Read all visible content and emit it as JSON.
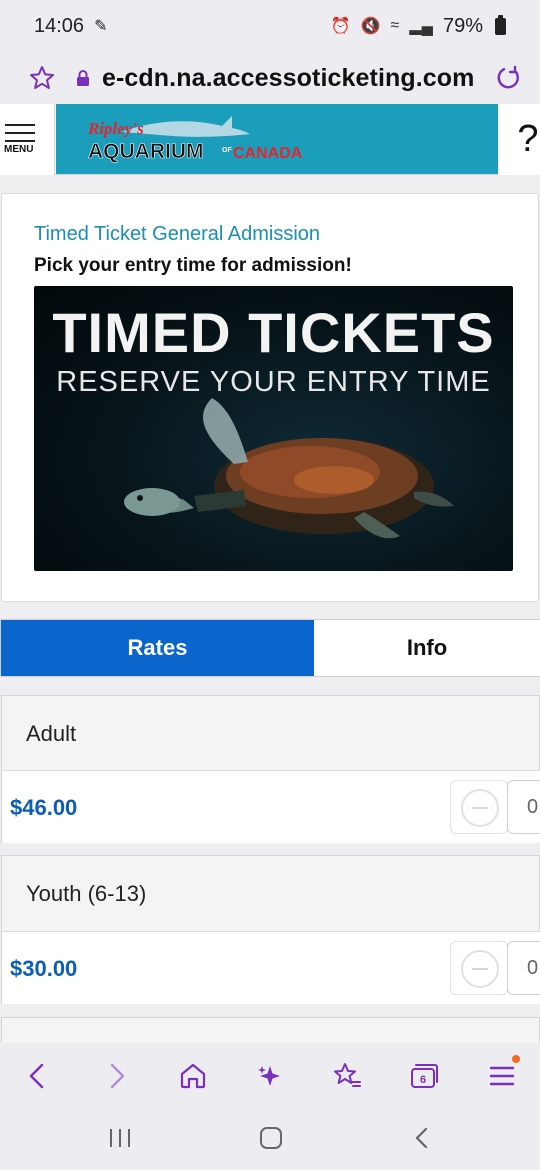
{
  "status_bar": {
    "time": "14:06",
    "battery": "79%"
  },
  "browser": {
    "url": "e-cdn.na.accessoticketing.com",
    "tab_count": "6"
  },
  "header": {
    "menu_label": "MENU",
    "logo_script": "Ripley's",
    "logo_main": "AQUARIUM",
    "logo_of": "OF",
    "logo_country": "CANADA",
    "help_label": "?"
  },
  "product": {
    "title": "Timed Ticket General Admission",
    "subtitle": "Pick your entry time for admission!",
    "banner_headline": "TIMED TICKETS",
    "banner_subheadline": "RESERVE YOUR ENTRY TIME"
  },
  "tabs": {
    "rates": "Rates",
    "info": "Info",
    "active": "rates"
  },
  "rates": [
    {
      "name": "Adult",
      "price": "$46.00",
      "quantity": "0"
    },
    {
      "name": "Youth (6-13)",
      "price": "$30.00",
      "quantity": "0"
    }
  ],
  "colors": {
    "accent_blue": "#0a66cc",
    "header_teal": "#1b9dbc",
    "price_blue": "#0b5eb4",
    "browser_purple": "#7b2fbf",
    "logo_red": "#e3262d"
  }
}
